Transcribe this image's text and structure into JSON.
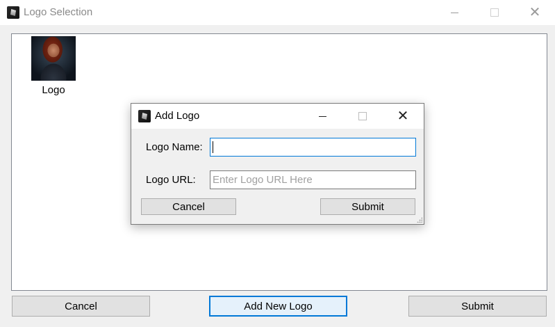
{
  "window": {
    "title": "Logo Selection",
    "app_icon": "app-logo-icon"
  },
  "logo_list": {
    "items": [
      {
        "label": "Logo",
        "image": "character-portrait"
      }
    ]
  },
  "footer": {
    "cancel_label": "Cancel",
    "add_new_label": "Add New Logo",
    "submit_label": "Submit"
  },
  "dialog": {
    "title": "Add Logo",
    "name_label": "Logo Name:",
    "name_value": "",
    "url_label": "Logo URL:",
    "url_placeholder": "Enter Logo URL Here",
    "cancel_label": "Cancel",
    "submit_label": "Submit"
  },
  "colors": {
    "accent": "#0078d7",
    "window_bg": "#f0f0f0",
    "button_bg": "#e1e1e1"
  }
}
